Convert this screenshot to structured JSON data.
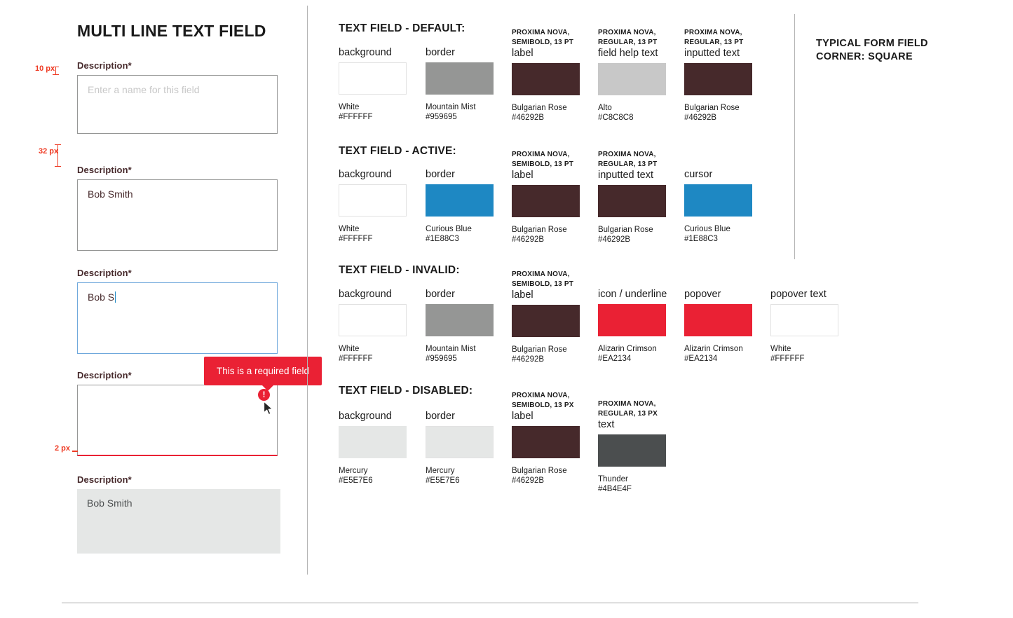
{
  "left_panel": {
    "title": "MULTI LINE TEXT FIELD",
    "fields": [
      {
        "label": "Description*",
        "placeholder": "Enter a name for this field",
        "value": "",
        "state": "default"
      },
      {
        "label": "Description*",
        "placeholder": "",
        "value": "Bob Smith",
        "state": "filled"
      },
      {
        "label": "Description*",
        "placeholder": "",
        "value": "Bob S",
        "state": "active"
      },
      {
        "label": "Description*",
        "placeholder": "",
        "value": "",
        "state": "invalid"
      },
      {
        "label": "Description*",
        "placeholder": "",
        "value": "Bob Smith",
        "state": "disabled"
      }
    ],
    "measurements": [
      {
        "text": "10 px"
      },
      {
        "text": "32 px"
      },
      {
        "text": "2 px"
      }
    ],
    "popover": {
      "text": "This is a required field",
      "icon": "exclamation-icon"
    }
  },
  "spec_panel": {
    "sections": [
      {
        "heading": "TEXT FIELD - DEFAULT:",
        "swatches": [
          {
            "font": "",
            "name": "background",
            "color": "#FFFFFF",
            "color_name": "White",
            "hex": "#FFFFFF",
            "outline": true
          },
          {
            "font": "",
            "name": "border",
            "color": "#959695",
            "color_name": "Mountain Mist",
            "hex": "#959695",
            "outline": false
          },
          {
            "font": "PROXIMA NOVA,\nSEMIBOLD, 13 PT",
            "name": "label",
            "color": "#46292B",
            "color_name": "Bulgarian Rose",
            "hex": "#46292B",
            "outline": false
          },
          {
            "font": "PROXIMA NOVA,\nREGULAR, 13 PT",
            "name": "field help text",
            "color": "#C8C8C8",
            "color_name": "Alto",
            "hex": "#C8C8C8",
            "outline": false
          },
          {
            "font": "PROXIMA NOVA,\nREGULAR, 13 PT",
            "name": "inputted text",
            "color": "#46292B",
            "color_name": "Bulgarian Rose",
            "hex": "#46292B",
            "outline": false
          }
        ]
      },
      {
        "heading": "TEXT FIELD - ACTIVE:",
        "swatches": [
          {
            "font": "",
            "name": "background",
            "color": "#FFFFFF",
            "color_name": "White",
            "hex": "#FFFFFF",
            "outline": true
          },
          {
            "font": "",
            "name": "border",
            "color": "#1E88C3",
            "color_name": "Curious Blue",
            "hex": "#1E88C3",
            "outline": false
          },
          {
            "font": "PROXIMA NOVA,\nSEMIBOLD, 13 PT",
            "name": "label",
            "color": "#46292B",
            "color_name": "Bulgarian Rose",
            "hex": "#46292B",
            "outline": false
          },
          {
            "font": "PROXIMA NOVA,\nREGULAR, 13 PT",
            "name": "inputted text",
            "color": "#46292B",
            "color_name": "Bulgarian Rose",
            "hex": "#46292B",
            "outline": false
          },
          {
            "font": "",
            "name": "cursor",
            "color": "#1E88C3",
            "color_name": "Curious Blue",
            "hex": "#1E88C3",
            "outline": false
          }
        ]
      },
      {
        "heading": "TEXT FIELD - INVALID:",
        "swatches": [
          {
            "font": "",
            "name": "background",
            "color": "#FFFFFF",
            "color_name": "White",
            "hex": "#FFFFFF",
            "outline": true
          },
          {
            "font": "",
            "name": "border",
            "color": "#959695",
            "color_name": "Mountain Mist",
            "hex": "#959695",
            "outline": false
          },
          {
            "font": "PROXIMA NOVA,\nSEMIBOLD, 13 PT",
            "name": "label",
            "color": "#46292B",
            "color_name": "Bulgarian Rose",
            "hex": "#46292B",
            "outline": false
          },
          {
            "font": "",
            "name": "icon / underline",
            "color": "#EA2134",
            "color_name": "Alizarin Crimson",
            "hex": "#EA2134",
            "outline": false
          },
          {
            "font": "",
            "name": "popover",
            "color": "#EA2134",
            "color_name": "Alizarin Crimson",
            "hex": "#EA2134",
            "outline": false
          },
          {
            "font": "",
            "name": "popover text",
            "color": "#FFFFFF",
            "color_name": "White",
            "hex": "#FFFFFF",
            "outline": true
          }
        ]
      },
      {
        "heading": "TEXT FIELD - DISABLED:",
        "swatches": [
          {
            "font": "",
            "name": "background",
            "color": "#E5E7E6",
            "color_name": "Mercury",
            "hex": "#E5E7E6",
            "outline": false
          },
          {
            "font": "",
            "name": "border",
            "color": "#E5E7E6",
            "color_name": "Mercury",
            "hex": "#E5E7E6",
            "outline": true
          },
          {
            "font": "PROXIMA NOVA,\nSEMIBOLD, 13 PX",
            "name": "label",
            "color": "#46292B",
            "color_name": "Bulgarian Rose",
            "hex": "#46292B",
            "outline": false
          },
          {
            "font": "PROXIMA NOVA,\nREGULAR, 13 PX",
            "name": "text",
            "color": "#4B4E4F",
            "color_name": "Thunder",
            "hex": "#4B4E4F",
            "outline": false
          }
        ]
      }
    ]
  },
  "right_note": "TYPICAL FORM FIELD\nCORNER:  SQUARE"
}
